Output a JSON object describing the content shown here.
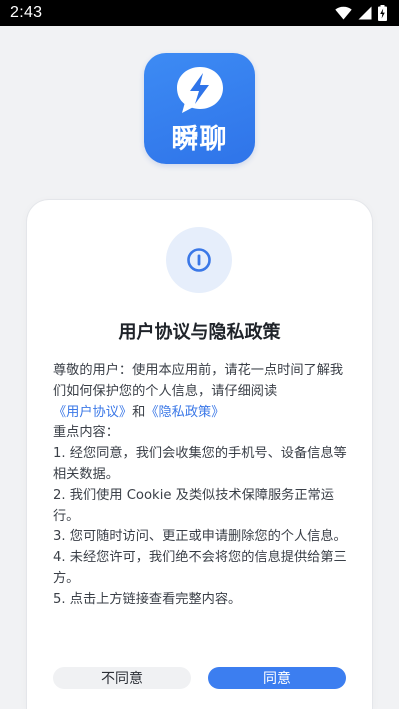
{
  "status_bar": {
    "time": "2:43"
  },
  "app": {
    "logo_text": "瞬聊",
    "brand_color": "#3c7ef0"
  },
  "dialog": {
    "title": "用户协议与隐私政策",
    "intro": "尊敬的用户：使用本应用前，请花一点时间了解我们如何保护您的个人信息，请仔细阅读",
    "user_agreement_link": "《用户协议》",
    "and_text": "和",
    "privacy_policy_link": "《隐私政策》",
    "key_points_heading": "重点内容：",
    "points": [
      "1. 经您同意，我们会收集您的手机号、设备信息等相关数据。",
      "2. 我们使用 Cookie 及类似技术保障服务正常运行。",
      "3. 您可随时访问、更正或申请删除您的个人信息。",
      "4. 未经您许可，我们绝不会将您的信息提供给第三方。",
      "5. 点击上方链接查看完整内容。"
    ],
    "decline_label": "不同意",
    "agree_label": "同意"
  },
  "icons": {
    "wifi": "wifi-icon",
    "signal": "cell-signal-icon",
    "battery": "battery-charging-icon",
    "info": "info-icon",
    "logo_bubble": "lightning-chat-bubble-icon"
  }
}
